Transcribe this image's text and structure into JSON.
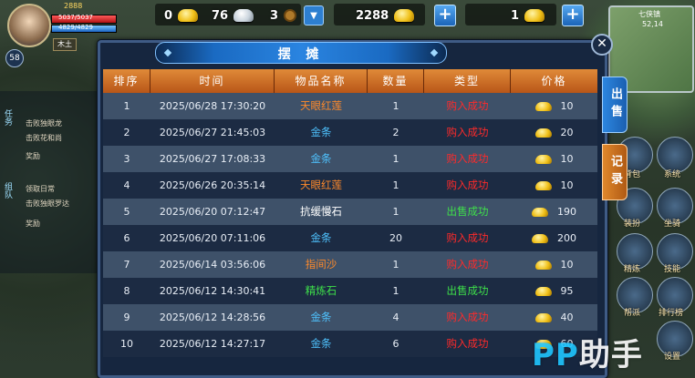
{
  "hud": {
    "player": {
      "level": "58",
      "hp_text": "5037/5037",
      "mp_text": "4829/4829",
      "element": "木土",
      "top_text": "2888"
    },
    "resources": [
      {
        "amount": "0",
        "icon": "gold-ingot-icon"
      },
      {
        "amount": "76",
        "icon": "silver-ingot-icon"
      },
      {
        "amount": "3",
        "icon": "copper-coin-icon"
      }
    ],
    "ingot_balance": "2288",
    "gold_balance": "1",
    "minimap": {
      "name": "七侠镇",
      "coords": "52,14"
    }
  },
  "left_panel": {
    "tabs": [
      "任务",
      "组队"
    ],
    "lines": [
      "击败独眼龙",
      "击败花和尚",
      "奖励",
      "领取日常",
      "击败独眼罗达",
      "奖励"
    ]
  },
  "side_menu": [
    "背包",
    "系统",
    "装扮",
    "坐骑",
    "精炼",
    "技能",
    "帮派",
    "排行榜",
    "设置"
  ],
  "stall": {
    "title": "摆 摊",
    "columns": [
      "排序",
      "时间",
      "物品名称",
      "数量",
      "类型",
      "价格"
    ],
    "rows": [
      {
        "rank": "1",
        "time": "2025/06/28 17:30:20",
        "item": "天眼红莲",
        "qty": "1",
        "type": "购入成功",
        "price": "10"
      },
      {
        "rank": "2",
        "time": "2025/06/27 21:45:03",
        "item": "金条",
        "qty": "2",
        "type": "购入成功",
        "price": "20"
      },
      {
        "rank": "3",
        "time": "2025/06/27 17:08:33",
        "item": "金条",
        "qty": "1",
        "type": "购入成功",
        "price": "10"
      },
      {
        "rank": "4",
        "time": "2025/06/26 20:35:14",
        "item": "天眼红莲",
        "qty": "1",
        "type": "购入成功",
        "price": "10"
      },
      {
        "rank": "5",
        "time": "2025/06/20 07:12:47",
        "item": "抗缓慢石",
        "qty": "1",
        "type": "出售成功",
        "price": "190"
      },
      {
        "rank": "6",
        "time": "2025/06/20 07:11:06",
        "item": "金条",
        "qty": "20",
        "type": "购入成功",
        "price": "200"
      },
      {
        "rank": "7",
        "time": "2025/06/14 03:56:06",
        "item": "指间沙",
        "qty": "1",
        "type": "购入成功",
        "price": "10"
      },
      {
        "rank": "8",
        "time": "2025/06/12 14:30:41",
        "item": "精炼石",
        "qty": "1",
        "type": "出售成功",
        "price": "95"
      },
      {
        "rank": "9",
        "time": "2025/06/12 14:28:56",
        "item": "金条",
        "qty": "4",
        "type": "购入成功",
        "price": "40"
      },
      {
        "rank": "10",
        "time": "2025/06/12 14:27:17",
        "item": "金条",
        "qty": "6",
        "type": "购入成功",
        "price": "60"
      }
    ],
    "tabs": {
      "sell": "出售",
      "record": "记录"
    }
  },
  "colors": {
    "item_orange": "#ff8a2a",
    "item_blue": "#4fc3ff",
    "item_white": "#ffffff",
    "item_green": "#3ee04a",
    "type_buy": "#ff2a2a",
    "type_sell": "#3ee04a"
  },
  "watermark": {
    "prefix": "PP",
    "suffix": "助手"
  }
}
